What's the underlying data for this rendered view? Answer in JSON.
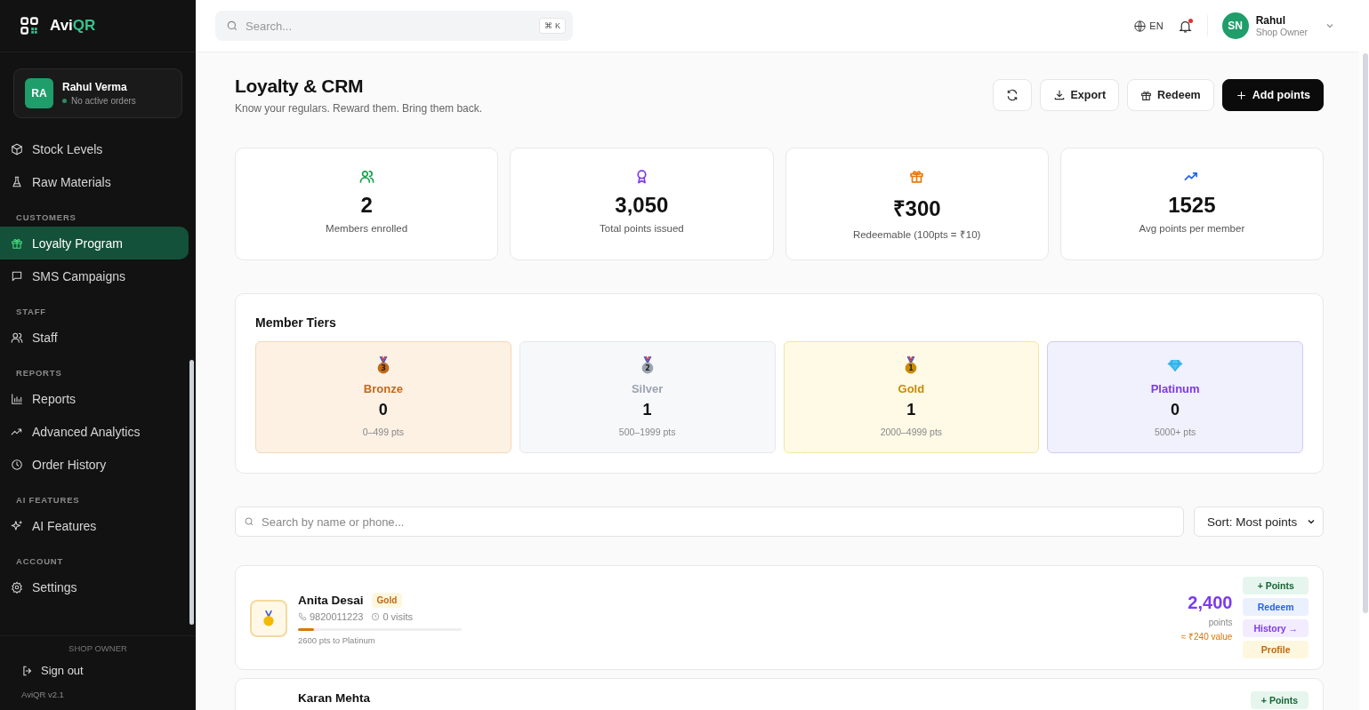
{
  "brand": {
    "name_a": "Avi",
    "name_b": "QR"
  },
  "user_card": {
    "initials": "RA",
    "name": "Rahul Verma",
    "status": "No active orders"
  },
  "sidebar": {
    "items": [
      {
        "kind": "item",
        "label": "Stock Levels",
        "selected": false
      },
      {
        "kind": "item",
        "label": "Raw Materials",
        "selected": false
      },
      {
        "kind": "section",
        "label": "CUSTOMERS"
      },
      {
        "kind": "item",
        "label": "Loyalty Program",
        "selected": true
      },
      {
        "kind": "item",
        "label": "SMS Campaigns",
        "selected": false
      },
      {
        "kind": "section",
        "label": "STAFF"
      },
      {
        "kind": "item",
        "label": "Staff",
        "selected": false
      },
      {
        "kind": "section",
        "label": "REPORTS"
      },
      {
        "kind": "item",
        "label": "Reports",
        "selected": false
      },
      {
        "kind": "item",
        "label": "Advanced Analytics",
        "selected": false
      },
      {
        "kind": "item",
        "label": "Order History",
        "selected": false
      },
      {
        "kind": "section",
        "label": "AI FEATURES"
      },
      {
        "kind": "item",
        "label": "AI Features",
        "selected": false
      },
      {
        "kind": "section",
        "label": "ACCOUNT"
      },
      {
        "kind": "item",
        "label": "Settings",
        "selected": false
      }
    ],
    "role": "SHOP OWNER",
    "sign_out": "Sign out",
    "version": "AviQR v2.1"
  },
  "topbar": {
    "search": {
      "placeholder": "Search..."
    },
    "shortcut": "⌘ K",
    "language": "EN",
    "notification": true,
    "user": {
      "initials": "SN",
      "name": "Rahul",
      "role": "Shop Owner"
    }
  },
  "header": {
    "title": "Loyalty & CRM",
    "subtitle": "Know your regulars. Reward them. Bring them back.",
    "buttons": [
      "Export",
      "Redeem",
      "Add points"
    ]
  },
  "stats": [
    {
      "value": "2",
      "label": "Members enrolled",
      "color": "#16a34a"
    },
    {
      "value": "3,050",
      "label": "Total points issued",
      "color": "#7c3aed"
    },
    {
      "value": "₹300",
      "label": "Redeemable (100pts = ₹10)",
      "color": "#ea7a0c"
    },
    {
      "value": "1525",
      "label": "Avg points per member",
      "color": "#2563eb"
    }
  ],
  "tiers": {
    "title": "Member Tiers",
    "items": [
      {
        "kind": "medal",
        "medal_number": "3",
        "name": "Bronze",
        "count": "0",
        "range": "0–499 pts",
        "color": "#c2691a"
      },
      {
        "kind": "medal",
        "medal_number": "2",
        "name": "Silver",
        "count": "1",
        "range": "500–1999 pts",
        "color": "#9ca3af"
      },
      {
        "kind": "medal",
        "medal_number": "1",
        "name": "Gold",
        "count": "1",
        "range": "2000–4999 pts",
        "color": "#ca8a04"
      },
      {
        "kind": "gem",
        "name": "Platinum",
        "count": "0",
        "range": "5000+ pts",
        "color": "#7c3aed"
      }
    ]
  },
  "member_search": {
    "placeholder": "Search by name or phone..."
  },
  "sort": {
    "value": "Sort: Most points"
  },
  "members": [
    {
      "name": "Anita Desai",
      "tier": "Gold",
      "phone": "9820011223",
      "visits": "0 visits",
      "level": 0.1,
      "progress_text": "2600 pts to Platinum",
      "points": "2,400",
      "points_label": "points",
      "value": "≈ ₹240 value",
      "actions": [
        "+ Points",
        "Redeem",
        "History →",
        "Profile"
      ]
    },
    {
      "name": "Karan Mehta",
      "actions": [
        "+ Points"
      ]
    }
  ]
}
